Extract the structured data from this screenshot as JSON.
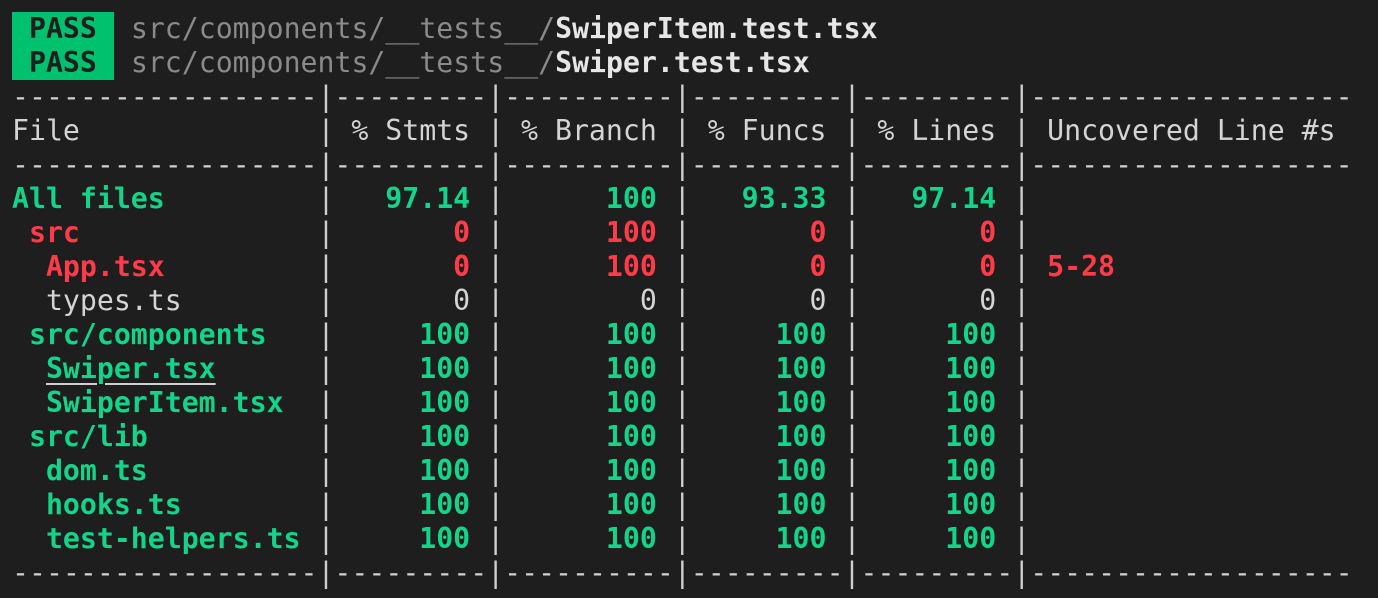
{
  "test_results": [
    {
      "status": "PASS",
      "dir": "src/components/__tests__/",
      "file": "SwiperItem.test.tsx"
    },
    {
      "status": "PASS",
      "dir": "src/components/__tests__/",
      "file": "Swiper.test.tsx"
    }
  ],
  "coverage_table": {
    "separator": "------------------|---------|----------|---------|---------|-------------------",
    "headers": [
      "File",
      "% Stmts",
      "% Branch",
      "% Funcs",
      "% Lines",
      "Uncovered Line #s"
    ],
    "rows": [
      {
        "indent": 0,
        "file": "All files",
        "stmts": "97.14",
        "branch": "100",
        "funcs": "93.33",
        "lines": "97.14",
        "uncovered": "",
        "status": "green"
      },
      {
        "indent": 1,
        "file": "src",
        "stmts": "0",
        "branch": "100",
        "funcs": "0",
        "lines": "0",
        "uncovered": "",
        "status": "red"
      },
      {
        "indent": 2,
        "file": "App.tsx",
        "stmts": "0",
        "branch": "100",
        "funcs": "0",
        "lines": "0",
        "uncovered": "5-28",
        "status": "red"
      },
      {
        "indent": 2,
        "file": "types.ts",
        "stmts": "0",
        "branch": "0",
        "funcs": "0",
        "lines": "0",
        "uncovered": "",
        "status": "plain"
      },
      {
        "indent": 1,
        "file": "src/components",
        "stmts": "100",
        "branch": "100",
        "funcs": "100",
        "lines": "100",
        "uncovered": "",
        "status": "green"
      },
      {
        "indent": 2,
        "file": "Swiper.tsx",
        "stmts": "100",
        "branch": "100",
        "funcs": "100",
        "lines": "100",
        "uncovered": "",
        "status": "green",
        "underlined": true
      },
      {
        "indent": 2,
        "file": "SwiperItem.tsx",
        "stmts": "100",
        "branch": "100",
        "funcs": "100",
        "lines": "100",
        "uncovered": "",
        "status": "green"
      },
      {
        "indent": 1,
        "file": "src/lib",
        "stmts": "100",
        "branch": "100",
        "funcs": "100",
        "lines": "100",
        "uncovered": "",
        "status": "green"
      },
      {
        "indent": 2,
        "file": "dom.ts",
        "stmts": "100",
        "branch": "100",
        "funcs": "100",
        "lines": "100",
        "uncovered": "",
        "status": "green"
      },
      {
        "indent": 2,
        "file": "hooks.ts",
        "stmts": "100",
        "branch": "100",
        "funcs": "100",
        "lines": "100",
        "uncovered": "",
        "status": "green"
      },
      {
        "indent": 2,
        "file": "test-helpers.ts",
        "stmts": "100",
        "branch": "100",
        "funcs": "100",
        "lines": "100",
        "uncovered": "",
        "status": "green"
      }
    ]
  },
  "colors": {
    "background": "#1e1e1e",
    "pass_badge": "#00c16e",
    "covered": "#14d48a",
    "uncovered": "#ff3b4a"
  }
}
